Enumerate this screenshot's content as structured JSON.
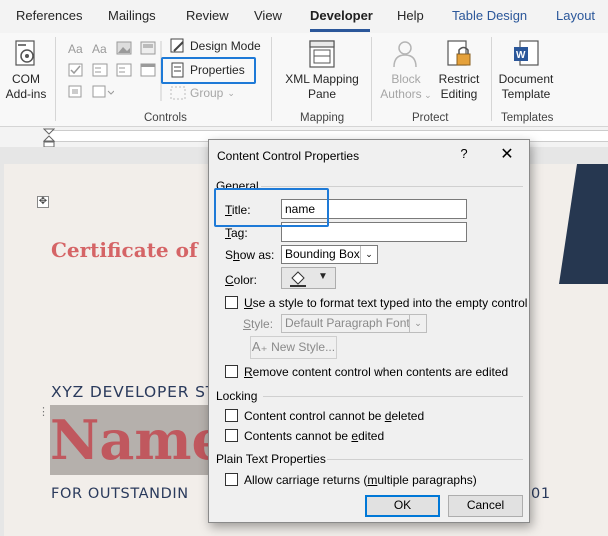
{
  "tabs": [
    {
      "label": "References",
      "active": false
    },
    {
      "label": "Mailings",
      "active": false
    },
    {
      "label": "Review",
      "active": false
    },
    {
      "label": "View",
      "active": false
    },
    {
      "label": "Developer",
      "active": true
    },
    {
      "label": "Help",
      "active": false
    },
    {
      "label": "Table Design",
      "active": false
    },
    {
      "label": "Layout",
      "active": false
    }
  ],
  "ribbon": {
    "com_addins": {
      "line1": "COM",
      "line2": "Add-ins"
    },
    "controls": {
      "group_label": "Controls",
      "design_mode": "Design Mode",
      "properties": "Properties",
      "group": "Group"
    },
    "mapping": {
      "group_label": "Mapping",
      "xml_line1": "XML Mapping",
      "xml_line2": "Pane"
    },
    "protect": {
      "group_label": "Protect",
      "block_line1": "Block",
      "block_line2": "Authors",
      "restrict_line1": "Restrict",
      "restrict_line2": "Editing"
    },
    "templates": {
      "group_label": "Templates",
      "doc_line1": "Document",
      "doc_line2": "Template"
    }
  },
  "document": {
    "certificate_title": "Certificate of",
    "xyz_line": "XYZ DEVELOPER ST",
    "name_placeholder": "Name",
    "outstanding_line": "FOR OUTSTANDIN",
    "outstanding_tail": "01"
  },
  "dialog": {
    "title": "Content Control Properties",
    "help": "?",
    "close": "✕",
    "general": "General",
    "title_label_u": "T",
    "title_label_rest": "itle:",
    "title_value": "name",
    "tag_label_u": "T",
    "tag_label_rest": "ag:",
    "tag_value": "",
    "show_as_label_pre": "S",
    "show_as_label_u": "h",
    "show_as_label_rest": "ow as:",
    "show_as_value": "Bounding Box",
    "color_label_u": "C",
    "color_label_rest": "olor:",
    "use_style_u": "U",
    "use_style_rest": "se a style to format text typed into the empty control",
    "style_label_u": "S",
    "style_label_rest": "tyle:",
    "style_value": "Default Paragraph Font",
    "new_style": "New Style...",
    "remove_pre": "",
    "remove_u": "R",
    "remove_rest": "emove content control when contents are edited",
    "locking": "Locking",
    "cannot_delete_pre": "Content control cannot be ",
    "cannot_delete_u": "d",
    "cannot_delete_rest": "eleted",
    "cannot_edit_pre": "Contents cannot be ",
    "cannot_edit_u": "e",
    "cannot_edit_rest": "dited",
    "plain_text": "Plain Text Properties",
    "allow_returns_pre": "Allow carriage returns (",
    "allow_returns_u": "m",
    "allow_returns_rest": "ultiple paragraphs)",
    "ok": "OK",
    "cancel": "Cancel",
    "checkboxes": {
      "use_style": false,
      "remove": false,
      "cannot_delete": false,
      "cannot_edit": false,
      "allow_returns": false
    }
  },
  "colors": {
    "accent": "#2b579a",
    "highlight": "#1e7ad7",
    "certificate_red": "#d56466",
    "doc_navy": "#2a3a5c"
  }
}
